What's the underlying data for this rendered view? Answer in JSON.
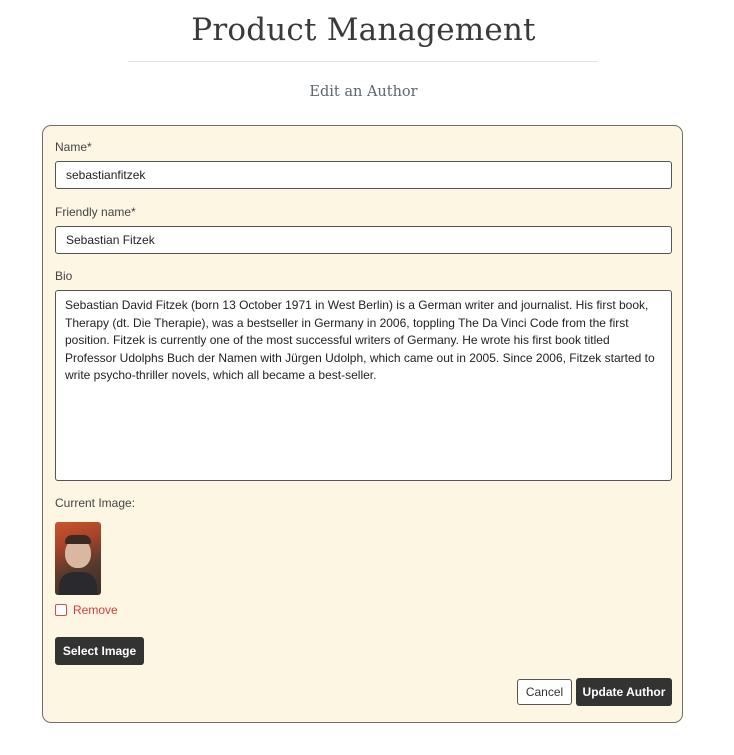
{
  "header": {
    "title": "Product Management",
    "subtitle": "Edit an Author"
  },
  "form": {
    "name_label": "Name*",
    "name_value": "sebastianfitzek",
    "friendly_name_label": "Friendly name*",
    "friendly_name_value": "Sebastian Fitzek",
    "bio_label": "Bio",
    "bio_value": "Sebastian David Fitzek (born 13 October 1971 in West Berlin) is a German writer and journalist. His first book, Therapy (dt. Die Therapie), was a bestseller in Germany in 2006, toppling The Da Vinci Code from the first position. Fitzek is currently one of the most successful writers of Germany. He wrote his first book titled Professor Udolphs Buch der Namen with Jürgen Udolph, which came out in 2005. Since 2006, Fitzek started to write psycho-thriller novels, which all became a best-seller.",
    "current_image_label": "Current Image:",
    "remove_label": "Remove",
    "remove_checked": false,
    "select_image_label": "Select Image",
    "cancel_label": "Cancel",
    "update_label": "Update Author"
  },
  "colors": {
    "card_background": "#fdf6e3",
    "button_dark": "#333333",
    "remove_red": "#d33c3c"
  }
}
